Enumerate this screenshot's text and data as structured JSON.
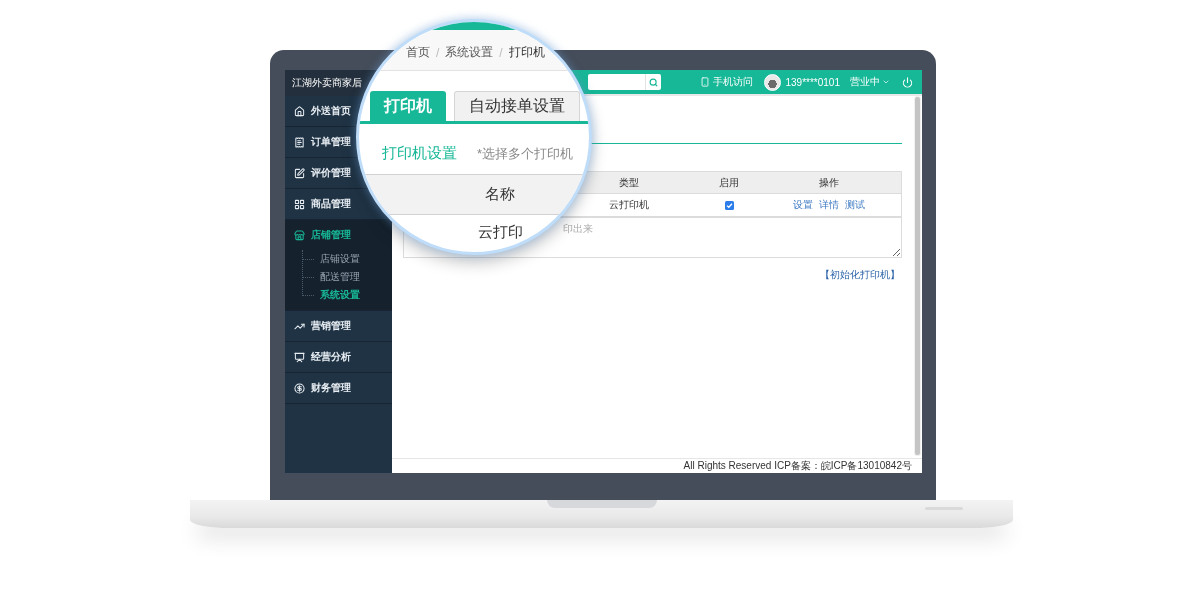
{
  "sidebar": {
    "title": "江湖外卖商家后",
    "items": [
      {
        "label": "外送首页",
        "selected": false,
        "expanded": false
      },
      {
        "label": "订单管理",
        "selected": false,
        "expanded": false
      },
      {
        "label": "评价管理",
        "selected": false,
        "expanded": false
      },
      {
        "label": "商品管理",
        "selected": false,
        "expanded": false
      },
      {
        "label": "店铺管理",
        "selected": true,
        "expanded": true,
        "children": [
          {
            "label": "店铺设置",
            "selected": false
          },
          {
            "label": "配送管理",
            "selected": false
          },
          {
            "label": "系统设置",
            "selected": true
          }
        ]
      },
      {
        "label": "营销管理",
        "selected": false,
        "expanded": false
      },
      {
        "label": "经营分析",
        "selected": false,
        "expanded": false
      },
      {
        "label": "财务管理",
        "selected": false,
        "expanded": false
      }
    ]
  },
  "top_bar": {
    "mobile_link": "手机访问",
    "account": "139****0101",
    "status": "营业中"
  },
  "printer_table": {
    "columns": [
      "类型",
      "启用",
      "操作"
    ],
    "rows": [
      {
        "type": "云打印机",
        "enabled": true,
        "actions": [
          "设置",
          "详情",
          "测试"
        ]
      }
    ],
    "note_placeholder": "印出来"
  },
  "init_link": "【初始化打印机】",
  "footer": "All Rights Reserved ICP备案：皖ICP备13010842号",
  "magnifier": {
    "breadcrumb": [
      {
        "label": "首页",
        "separator": "/"
      },
      {
        "label": "系统设置",
        "separator": "/"
      },
      {
        "label": "打印机"
      }
    ],
    "tabs": [
      {
        "label": "打印机",
        "selected": true
      },
      {
        "label": "自动接单设置",
        "selected": false
      }
    ],
    "section_title": "打印机设置",
    "section_hint": "*选择多个打印机",
    "table": {
      "columns": [
        "名称"
      ],
      "rows": [
        [
          "云打印"
        ]
      ]
    }
  }
}
